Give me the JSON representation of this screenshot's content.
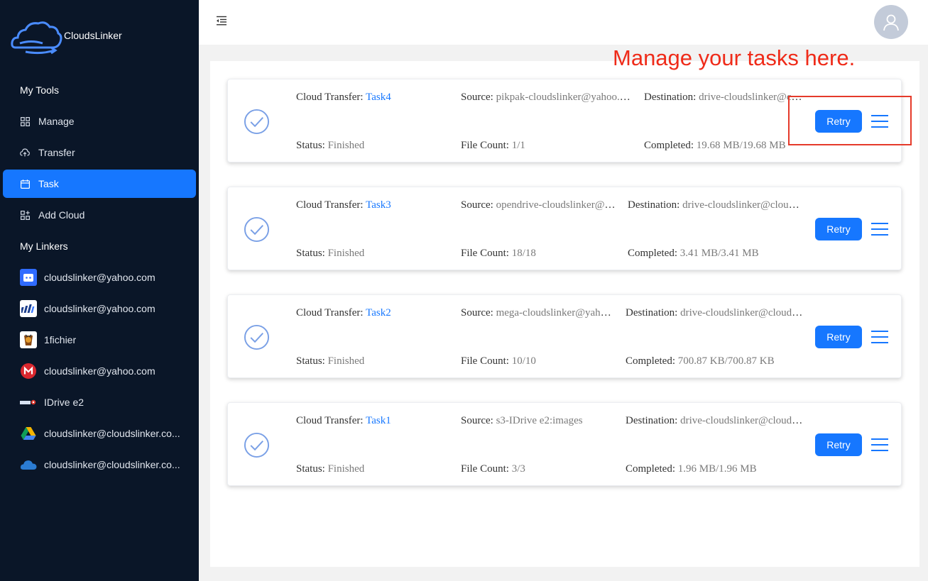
{
  "app": {
    "name": "CloudsLinker"
  },
  "sidebar": {
    "tools_title": "My Tools",
    "tools": [
      {
        "label": "Manage",
        "icon": "grid-icon"
      },
      {
        "label": "Transfer",
        "icon": "cloud-upload-icon"
      },
      {
        "label": "Task",
        "icon": "calendar-icon",
        "active": true
      },
      {
        "label": "Add Cloud",
        "icon": "apps-add-icon"
      }
    ],
    "linkers_title": "My Linkers",
    "linkers": [
      {
        "label": "cloudslinker@yahoo.com",
        "icon": "pikpak-icon"
      },
      {
        "label": "cloudslinker@yahoo.com",
        "icon": "opendrive-icon"
      },
      {
        "label": "1fichier",
        "icon": "1fichier-icon"
      },
      {
        "label": "cloudslinker@yahoo.com",
        "icon": "mega-icon"
      },
      {
        "label": "IDrive e2",
        "icon": "idrive-icon"
      },
      {
        "label": "cloudslinker@cloudslinker.co...",
        "icon": "google-drive-icon"
      },
      {
        "label": "cloudslinker@cloudslinker.co...",
        "icon": "onedrive-icon"
      }
    ]
  },
  "annotation": {
    "text": "Manage your tasks here.",
    "color": "#ef2b19"
  },
  "labels": {
    "cloud_transfer": "Cloud Transfer: ",
    "source": "Source: ",
    "destination": "Destination: ",
    "status": "Status: ",
    "file_count": "File Count: ",
    "completed": "Completed: ",
    "retry": "Retry"
  },
  "tasks": [
    {
      "name": "Task4",
      "source": "pikpak-cloudslinker@yahoo.com",
      "destination": "drive-cloudslinker@cloudslinker.com",
      "status": "Finished",
      "file_count": "1/1",
      "completed": "19.68 MB/19.68 MB"
    },
    {
      "name": "Task3",
      "source": "opendrive-cloudslinker@yahoo.com",
      "destination": "drive-cloudslinker@cloudslinker.com",
      "status": "Finished",
      "file_count": "18/18",
      "completed": "3.41 MB/3.41 MB"
    },
    {
      "name": "Task2",
      "source": "mega-cloudslinker@yahoo.com",
      "destination": "drive-cloudslinker@cloudslinker.com",
      "status": "Finished",
      "file_count": "10/10",
      "completed": "700.87 KB/700.87 KB"
    },
    {
      "name": "Task1",
      "source": "s3-IDrive e2:images",
      "destination": "drive-cloudslinker@cloudslinker.com",
      "status": "Finished",
      "file_count": "3/3",
      "completed": "1.96 MB/1.96 MB"
    }
  ],
  "colors": {
    "sidebar_bg": "#0a1628",
    "accent": "#1677ff",
    "annotation": "#ef2b19"
  }
}
